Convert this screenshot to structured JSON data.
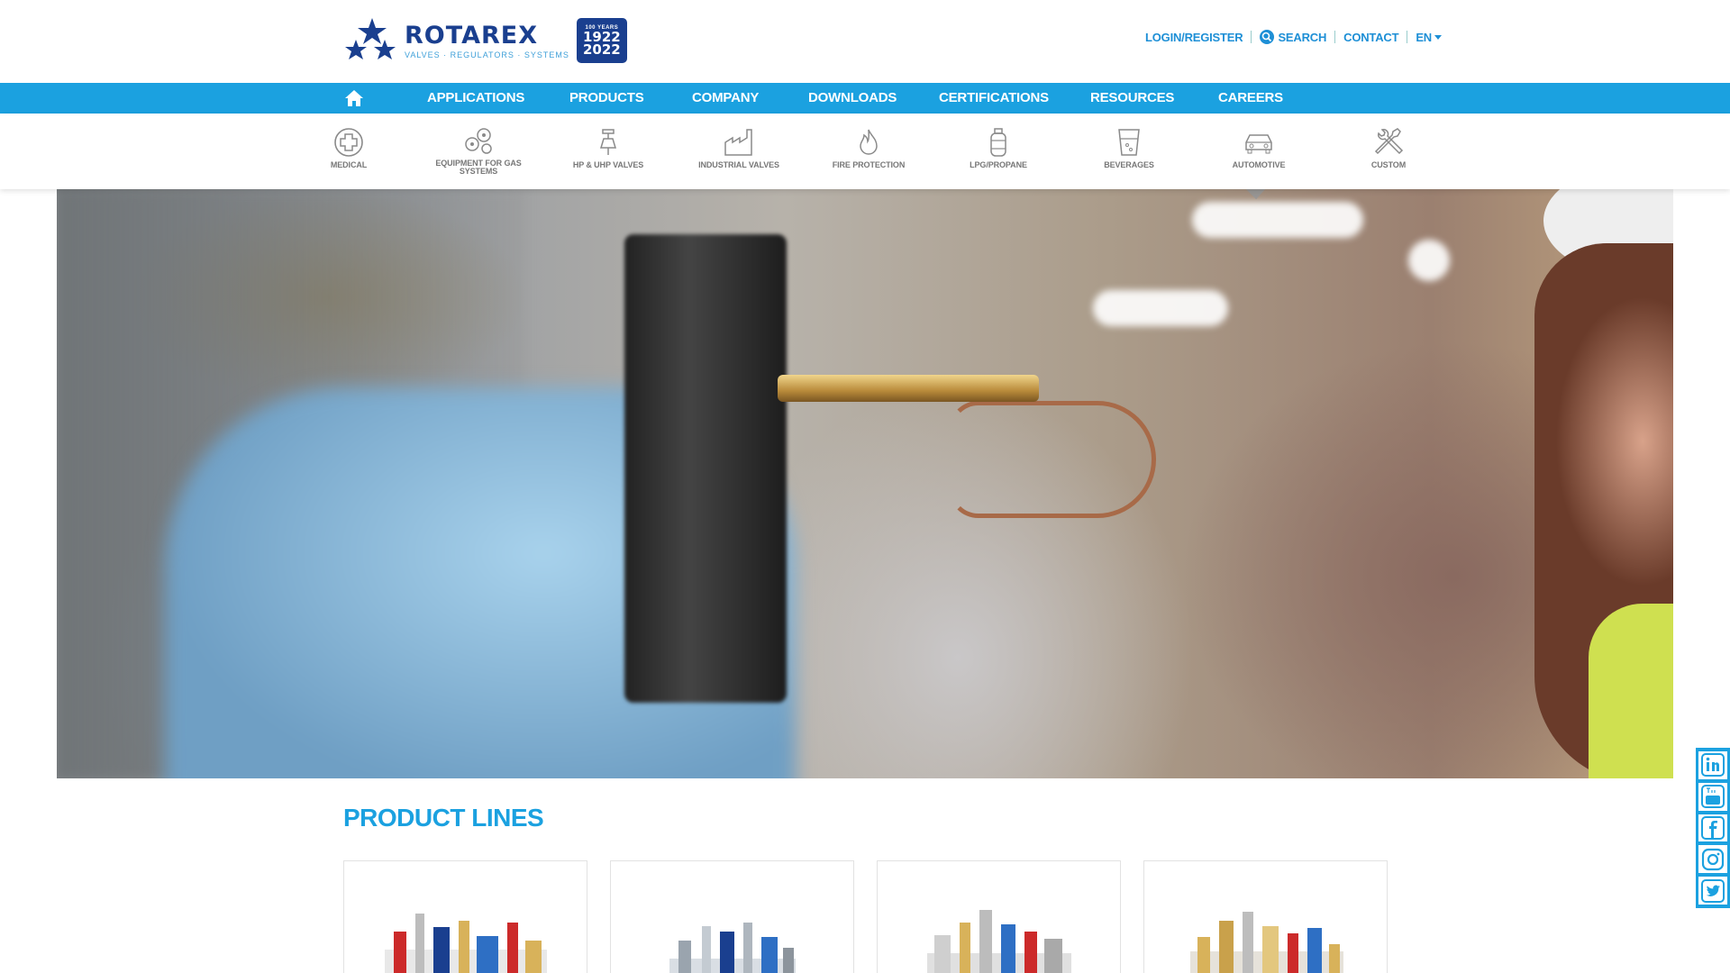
{
  "brand": {
    "name": "ROTAREX",
    "tagline": "VALVES · REGULATORS · SYSTEMS",
    "badge_top": "100 YEARS",
    "badge_year1": "1922",
    "badge_year2": "2022",
    "primary_color": "#1a3f8f",
    "accent_color": "#1ba1e0"
  },
  "top_links": {
    "login": "LOGIN/REGISTER",
    "search": "SEARCH",
    "contact": "CONTACT",
    "language": "EN"
  },
  "nav": {
    "home_icon": "home-icon",
    "items": [
      "APPLICATIONS",
      "PRODUCTS",
      "COMPANY",
      "DOWNLOADS",
      "CERTIFICATIONS",
      "RESOURCES",
      "CAREERS"
    ]
  },
  "subnav": {
    "items": [
      {
        "label": "MEDICAL",
        "icon": "medical-cross-icon"
      },
      {
        "label": "EQUIPMENT FOR GAS",
        "label2": "SYSTEMS",
        "icon": "gas-equipment-icon"
      },
      {
        "label": "HP & UHP VALVES",
        "icon": "valve-icon"
      },
      {
        "label": "INDUSTRIAL VALVES",
        "icon": "factory-icon"
      },
      {
        "label": "FIRE PROTECTION",
        "icon": "flame-icon"
      },
      {
        "label": "LPG/PROPANE",
        "icon": "gas-cylinder-icon"
      },
      {
        "label": "BEVERAGES",
        "icon": "beverage-glass-icon"
      },
      {
        "label": "AUTOMOTIVE",
        "icon": "car-icon"
      },
      {
        "label": "CUSTOM",
        "icon": "tools-icon"
      }
    ]
  },
  "hero": {
    "image": "industrial-worker-gas-valve-photo"
  },
  "social": [
    "linkedin-icon",
    "youtube-icon",
    "facebook-icon",
    "instagram-icon",
    "twitter-icon"
  ],
  "product_lines": {
    "title": "PRODUCT LINES",
    "cards": [
      "product-line-card-1",
      "product-line-card-2",
      "product-line-card-3",
      "product-line-card-4"
    ]
  }
}
